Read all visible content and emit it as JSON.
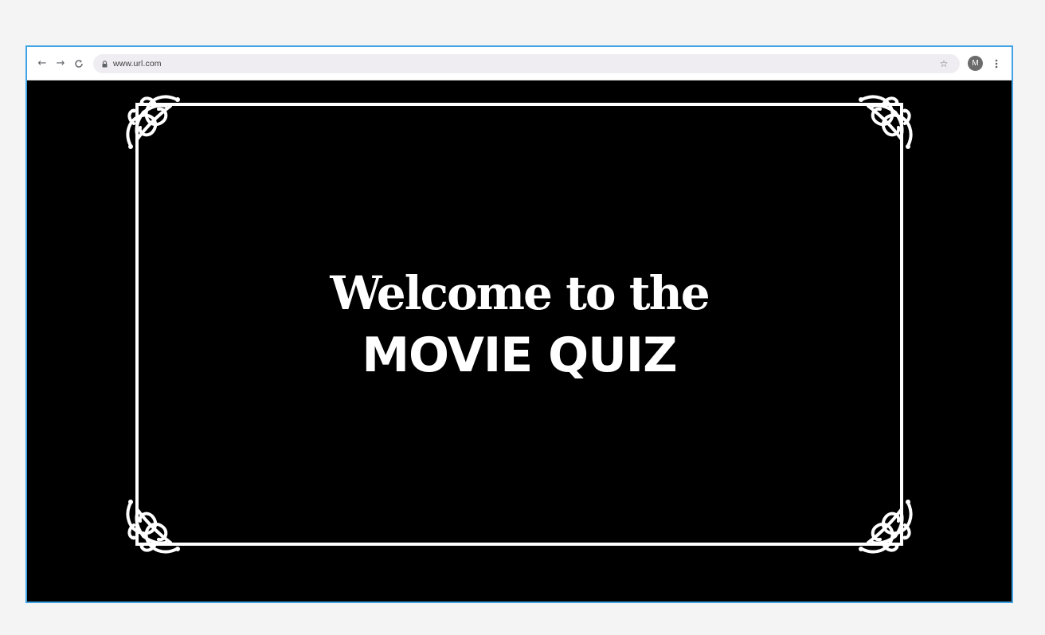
{
  "browser": {
    "url": "www.url.com",
    "profile_initial": "M",
    "nav_icons": [
      "back-arrow-icon",
      "forward-arrow-icon",
      "reload-icon"
    ],
    "toolbar_icons": [
      "lock-icon",
      "star-icon",
      "kebab-menu-icon"
    ]
  },
  "page": {
    "background_color": "#000000",
    "title_line1": "Welcome to the",
    "title_line2": "MOVIE QUIZ",
    "frame_color": "#ffffff",
    "frame_style": "silent-film ornamental border with scroll corners"
  },
  "colors": {
    "window_border": "#3fa3e6",
    "toolbar_bg": "#ffffff",
    "address_bar_bg": "#efedf1",
    "avatar_bg": "#6b6b6b"
  }
}
